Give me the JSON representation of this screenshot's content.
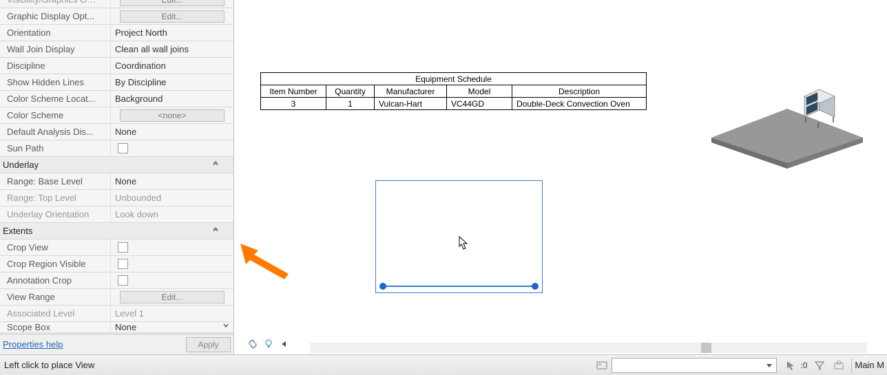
{
  "properties": {
    "rows": [
      {
        "label": "Visibility/Graphics O…",
        "value": "Edit...",
        "type": "btn",
        "dimmed": true
      },
      {
        "label": "Graphic Display Opt...",
        "value": "Edit...",
        "type": "btn"
      },
      {
        "label": "Orientation",
        "value": "Project North",
        "type": "text"
      },
      {
        "label": "Wall Join Display",
        "value": "Clean all wall joins",
        "type": "text"
      },
      {
        "label": "Discipline",
        "value": "Coordination",
        "type": "text"
      },
      {
        "label": "Show Hidden Lines",
        "value": "By Discipline",
        "type": "text"
      },
      {
        "label": "Color Scheme Locat...",
        "value": "Background",
        "type": "text"
      },
      {
        "label": "Color Scheme",
        "value": "<none>",
        "type": "btncenter"
      },
      {
        "label": "Default Analysis Dis...",
        "value": "None",
        "type": "text"
      },
      {
        "label": "Sun Path",
        "value": "",
        "type": "check"
      }
    ],
    "group_underlay": "Underlay",
    "underlay_rows": [
      {
        "label": "Range: Base Level",
        "value": "None",
        "type": "text"
      },
      {
        "label": "Range: Top Level",
        "value": "Unbounded",
        "type": "text",
        "dimmed": true
      },
      {
        "label": "Underlay Orientation",
        "value": "Look down",
        "type": "text",
        "dimmed": true
      }
    ],
    "group_extents": "Extents",
    "extents_rows": [
      {
        "label": "Crop View",
        "value": "",
        "type": "check"
      },
      {
        "label": "Crop Region Visible",
        "value": "",
        "type": "check"
      },
      {
        "label": "Annotation Crop",
        "value": "",
        "type": "check"
      },
      {
        "label": "View Range",
        "value": "Edit...",
        "type": "btn"
      },
      {
        "label": "Associated Level",
        "value": "Level 1",
        "type": "text",
        "dimmed": true
      },
      {
        "label": "Scope Box",
        "value": "None",
        "type": "text"
      }
    ],
    "help_label": "Properties help",
    "apply_label": "Apply"
  },
  "schedule": {
    "title": "Equipment Schedule",
    "columns": [
      "Item Number",
      "Quantity",
      "Manufacturer",
      "Model",
      "Description"
    ],
    "row": [
      "3",
      "1",
      "Vulcan-Hart",
      "VC44GD",
      "Double-Deck Convection Oven"
    ]
  },
  "statusbar": {
    "message": "Left click to place View",
    "selection_count": ":0",
    "model_label": "Main M"
  }
}
